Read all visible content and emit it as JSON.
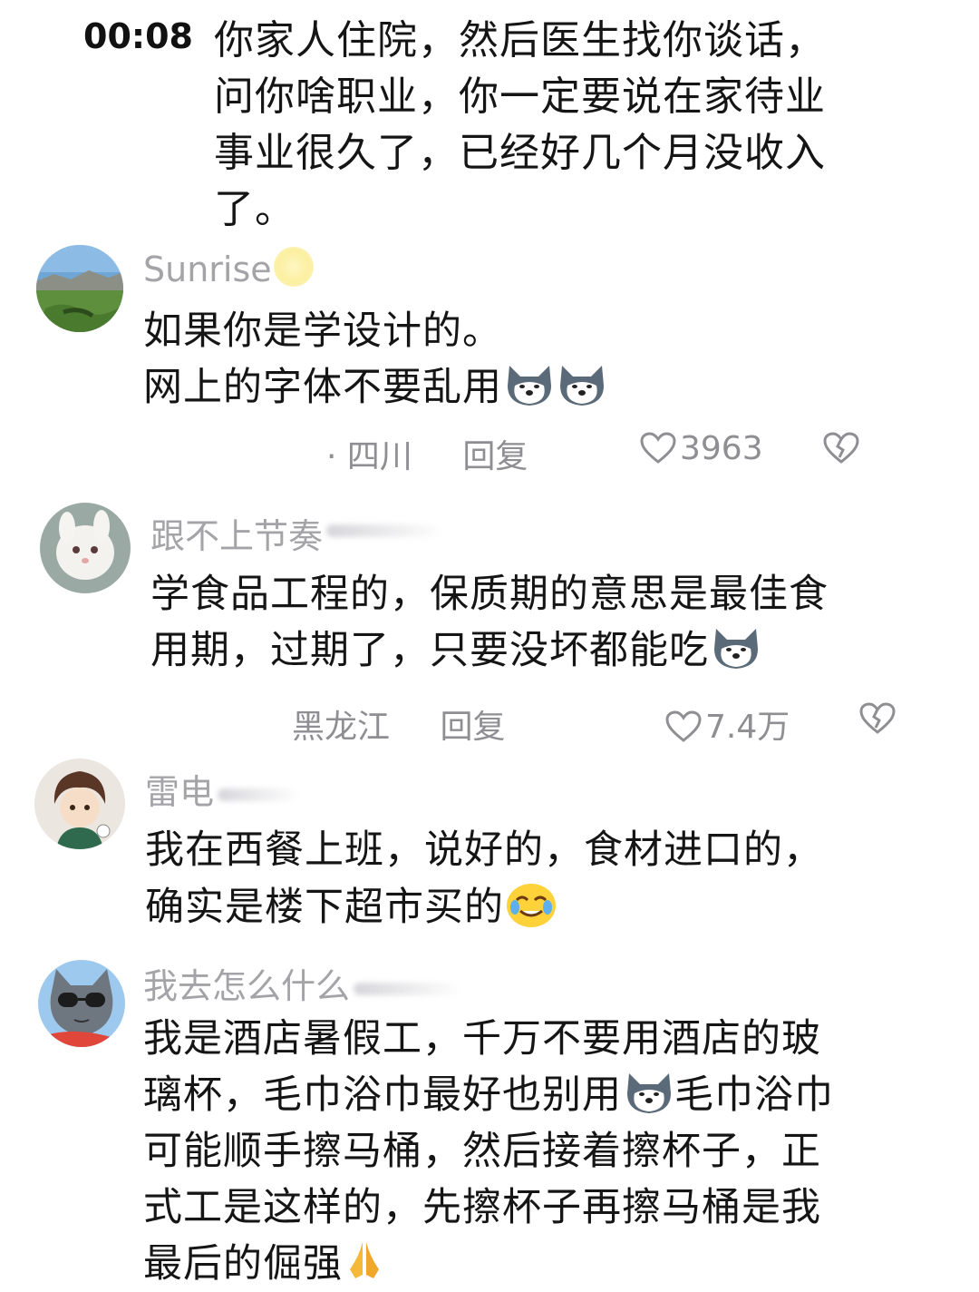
{
  "header": {
    "timestamp": "00:08",
    "lines": [
      "你家人住院，然后医生找你谈话，",
      "问你啥职业，你一定要说在家待业",
      "事业很久了，已经好几个月没收入",
      "了。"
    ]
  },
  "comments": [
    {
      "username": "Sunrise",
      "lines": [
        "如果你是学设计的。",
        "网上的字体不要乱用"
      ],
      "location": "· 四川",
      "reply_label": "回复",
      "likes": "3963"
    },
    {
      "username": "跟不上节奏",
      "lines": [
        "学食品工程的，保质期的意思是最佳食",
        "用期，过期了，只要没坏都能吃"
      ],
      "location": "黑龙江",
      "reply_label": "回复",
      "likes": "7.4万"
    },
    {
      "username": "雷电",
      "lines": [
        "我在西餐上班，说好的，食材进口的，",
        "确实是楼下超市买的"
      ]
    },
    {
      "username": "我去怎么什么",
      "lines": [
        "我是酒店暑假工，千万不要用酒店的玻",
        "璃杯，毛巾浴巾最好也别用",
        "毛巾浴巾",
        "可能顺手擦马桶，然后接着擦杯子，正",
        "式工是这样的，先擦杯子再擦马桶是我",
        "最后的倔强"
      ]
    }
  ],
  "colors": {
    "text": "#151515",
    "username": "#a4a4a8",
    "meta": "#8e8e93"
  },
  "icons": [
    "husky-emoji",
    "crying-laugh-emoji",
    "pray-emoji",
    "heart-outline-icon",
    "broken-heart-icon"
  ]
}
